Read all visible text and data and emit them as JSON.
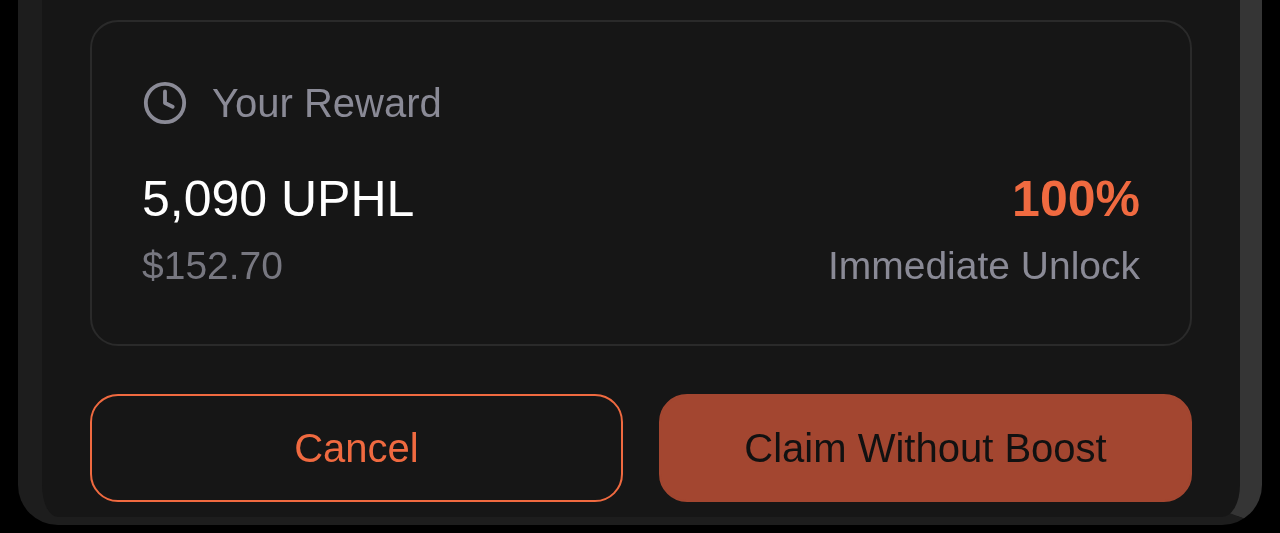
{
  "reward": {
    "label": "Your Reward",
    "amount": "5,090 UPHL",
    "usd": "$152.70",
    "percent": "100%",
    "unlock": "Immediate Unlock"
  },
  "buttons": [
    {
      "label": "Cancel",
      "kind": "outline"
    },
    {
      "label": "Claim Without Boost",
      "kind": "filled"
    }
  ]
}
